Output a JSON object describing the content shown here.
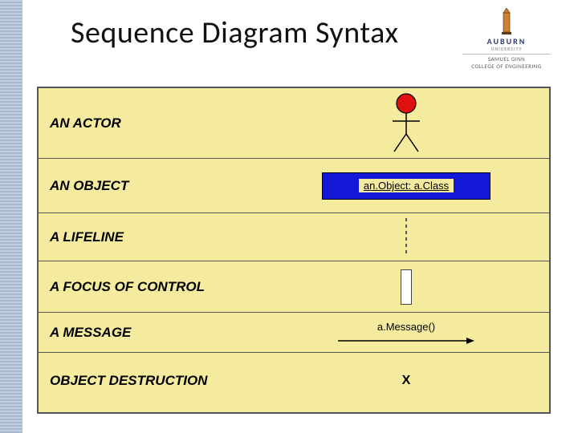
{
  "title": "Sequence Diagram Syntax",
  "logo": {
    "name": "AUBURN",
    "sub1": "UNIVERSITY",
    "sub2": "SAMUEL GINN",
    "sub3": "COLLEGE OF ENGINEERING"
  },
  "rows": [
    {
      "label": "AN ACTOR"
    },
    {
      "label": "AN OBJECT",
      "object_text": "an.Object: a.Class"
    },
    {
      "label": "A LIFELINE"
    },
    {
      "label": "A FOCUS OF CONTROL"
    },
    {
      "label": "A MESSAGE",
      "message_text": "a.Message()"
    },
    {
      "label": "OBJECT DESTRUCTION",
      "symbol": "X"
    }
  ]
}
